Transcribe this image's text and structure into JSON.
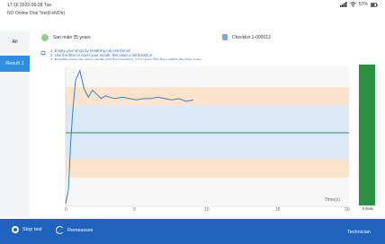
{
  "status": {
    "time": "17:16  2022-06-28  Tue",
    "battery": "57%",
    "icons": [
      "signal-icon",
      "wifi-icon",
      "battery-icon"
    ]
  },
  "app": {
    "title": "NO Online Oral Test(FeNOo)"
  },
  "sidebar": {
    "items": [
      {
        "label": "All",
        "active": false
      },
      {
        "label": "Result 1",
        "active": true
      }
    ]
  },
  "patient": {
    "info": "Sari   male   35 years",
    "checklist": "Checklist 1-000013"
  },
  "instructions": [
    "1. Empty your lungs by breathing out into the air",
    "2. Use the filter to cover your mouth, then take a full breath in",
    "3. Breathe back out again gently into the machine, try to keep the flow within the blue zone."
  ],
  "chart_data": {
    "type": "line",
    "xlabel": "Time(s)",
    "xlim": [
      0,
      20
    ],
    "x_ticks": [
      "0",
      "5",
      "10",
      "15",
      "20"
    ],
    "bands": [
      "orange",
      "blue",
      "orange"
    ],
    "target_line": "green",
    "series": [
      {
        "x": [
          0,
          0.2,
          0.35,
          0.5,
          0.7,
          1.0,
          1.3,
          1.6,
          1.9,
          2.2,
          2.5,
          2.8,
          3.1,
          3.5,
          4.0,
          4.5,
          5.0,
          5.5,
          6.0,
          6.5,
          7.0,
          7.5,
          8.0,
          8.5,
          9.0
        ],
        "y": [
          0.02,
          0.12,
          0.45,
          0.68,
          0.9,
          0.97,
          0.84,
          0.78,
          0.83,
          0.8,
          0.77,
          0.79,
          0.78,
          0.77,
          0.78,
          0.77,
          0.76,
          0.77,
          0.77,
          0.78,
          0.77,
          0.76,
          0.77,
          0.75,
          0.76
        ]
      }
    ]
  },
  "inhale": {
    "label": "Inhale",
    "level": 1.0,
    "color": "#2d8f41"
  },
  "bottom": {
    "stop": "Stop test",
    "remeasure": "Remeasure",
    "technician": "Technician"
  }
}
